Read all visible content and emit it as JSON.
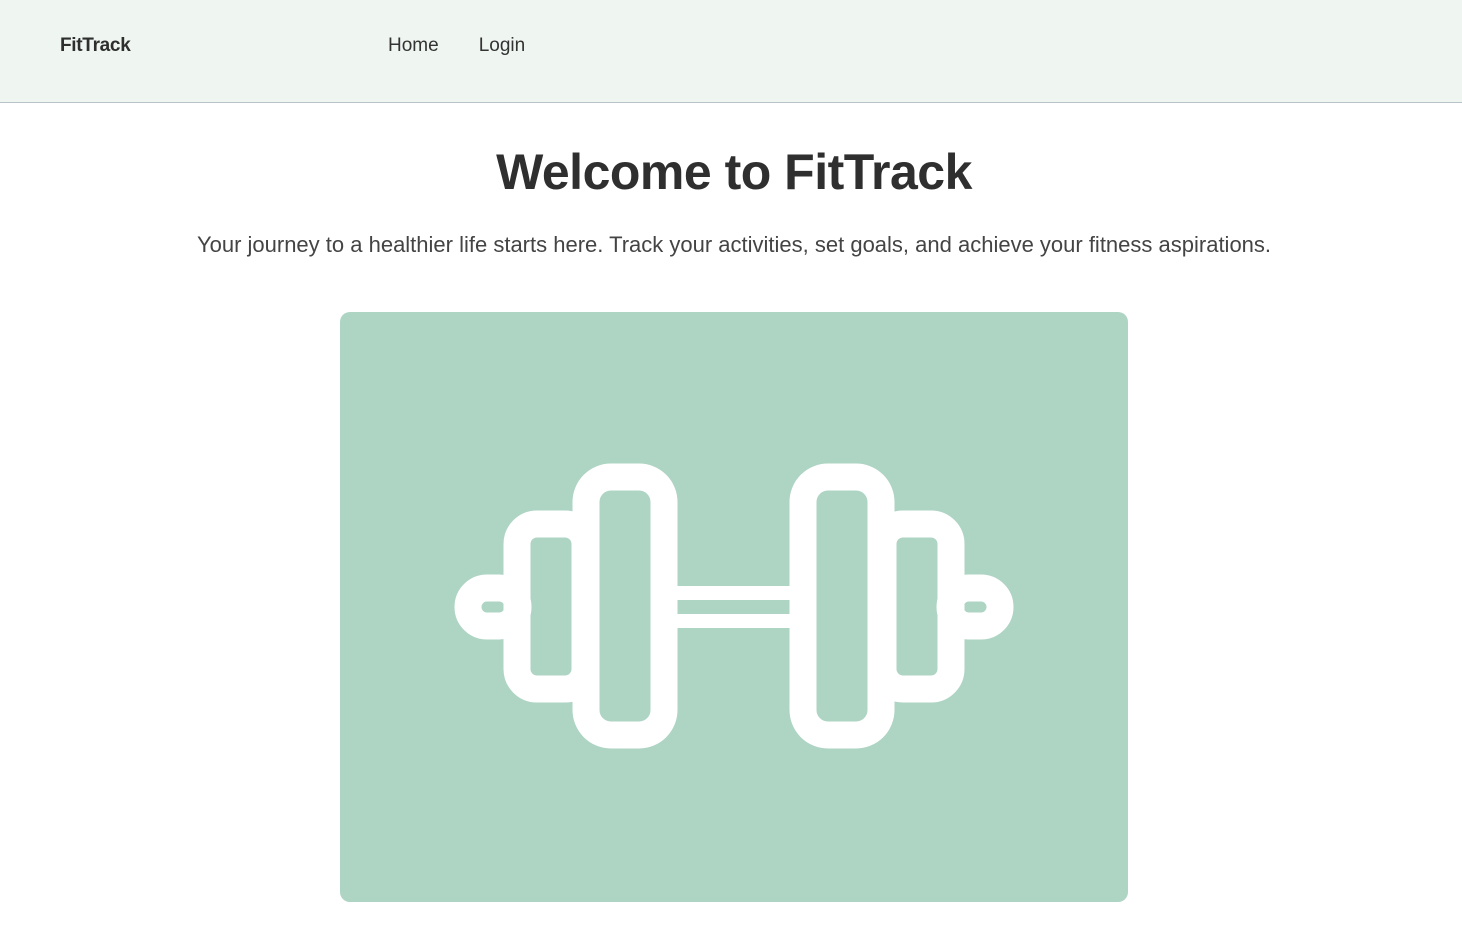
{
  "header": {
    "brand": "FitTrack",
    "nav": [
      {
        "label": "Home"
      },
      {
        "label": "Login"
      }
    ]
  },
  "hero": {
    "title": "Welcome to FitTrack",
    "subtitle": "Your journey to a healthier life starts here. Track your activities, set goals, and achieve your fitness aspirations.",
    "image_icon": "dumbbell-icon"
  },
  "colors": {
    "header_bg": "#eff5f1",
    "image_bg": "#aed4c4",
    "icon": "#ffffff",
    "text": "#333333"
  }
}
